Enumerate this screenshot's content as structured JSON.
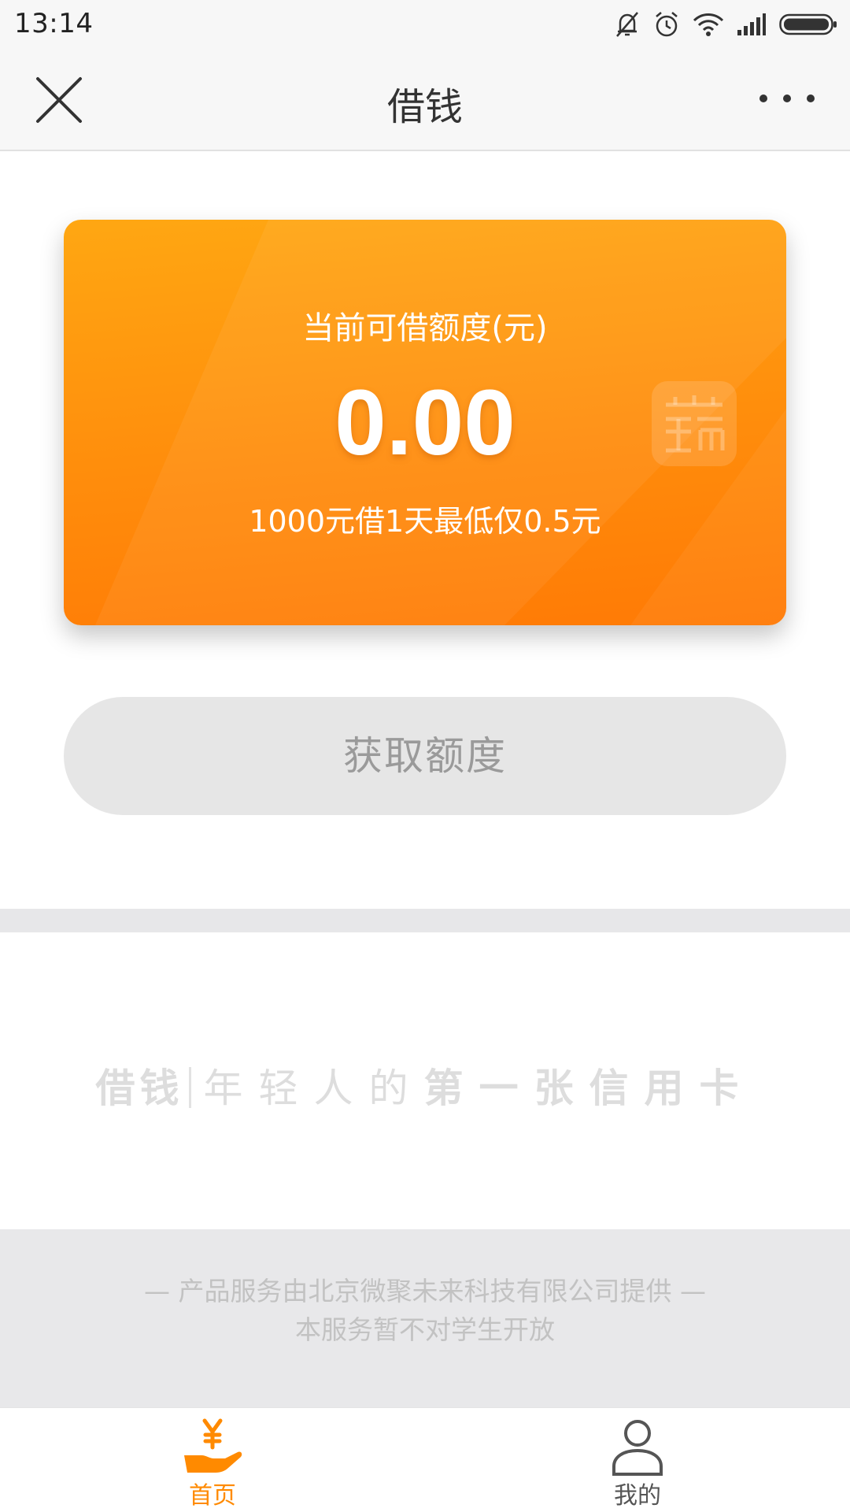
{
  "status_bar": {
    "time": "13:14",
    "icons": [
      "mute-bell-icon",
      "alarm-icon",
      "wifi-icon",
      "signal-icon",
      "battery-icon"
    ]
  },
  "navbar": {
    "title": "借钱",
    "close_icon": "close-icon",
    "more_icon": "more-icon"
  },
  "card": {
    "label": "当前可借额度(元)",
    "amount": "0.00",
    "promo": "1000元借1天最低仅0.5元",
    "logo_icon": "brand-logo-icon",
    "colors": {
      "start": "#ffa712",
      "end": "#ff7a05"
    }
  },
  "button": {
    "label": "获取额度"
  },
  "slogan": {
    "brand": "借钱",
    "part1": "年轻人的",
    "part2": "第一张信用卡"
  },
  "footer": {
    "line1": "— 产品服务由北京微聚未来科技有限公司提供 —",
    "line2": "本服务暂不对学生开放"
  },
  "tab_bar": {
    "tabs": [
      {
        "label": "首页",
        "icon": "hand-yen-icon",
        "active": true
      },
      {
        "label": "我的",
        "icon": "person-icon",
        "active": false
      }
    ],
    "accent": "#ff8a00"
  }
}
